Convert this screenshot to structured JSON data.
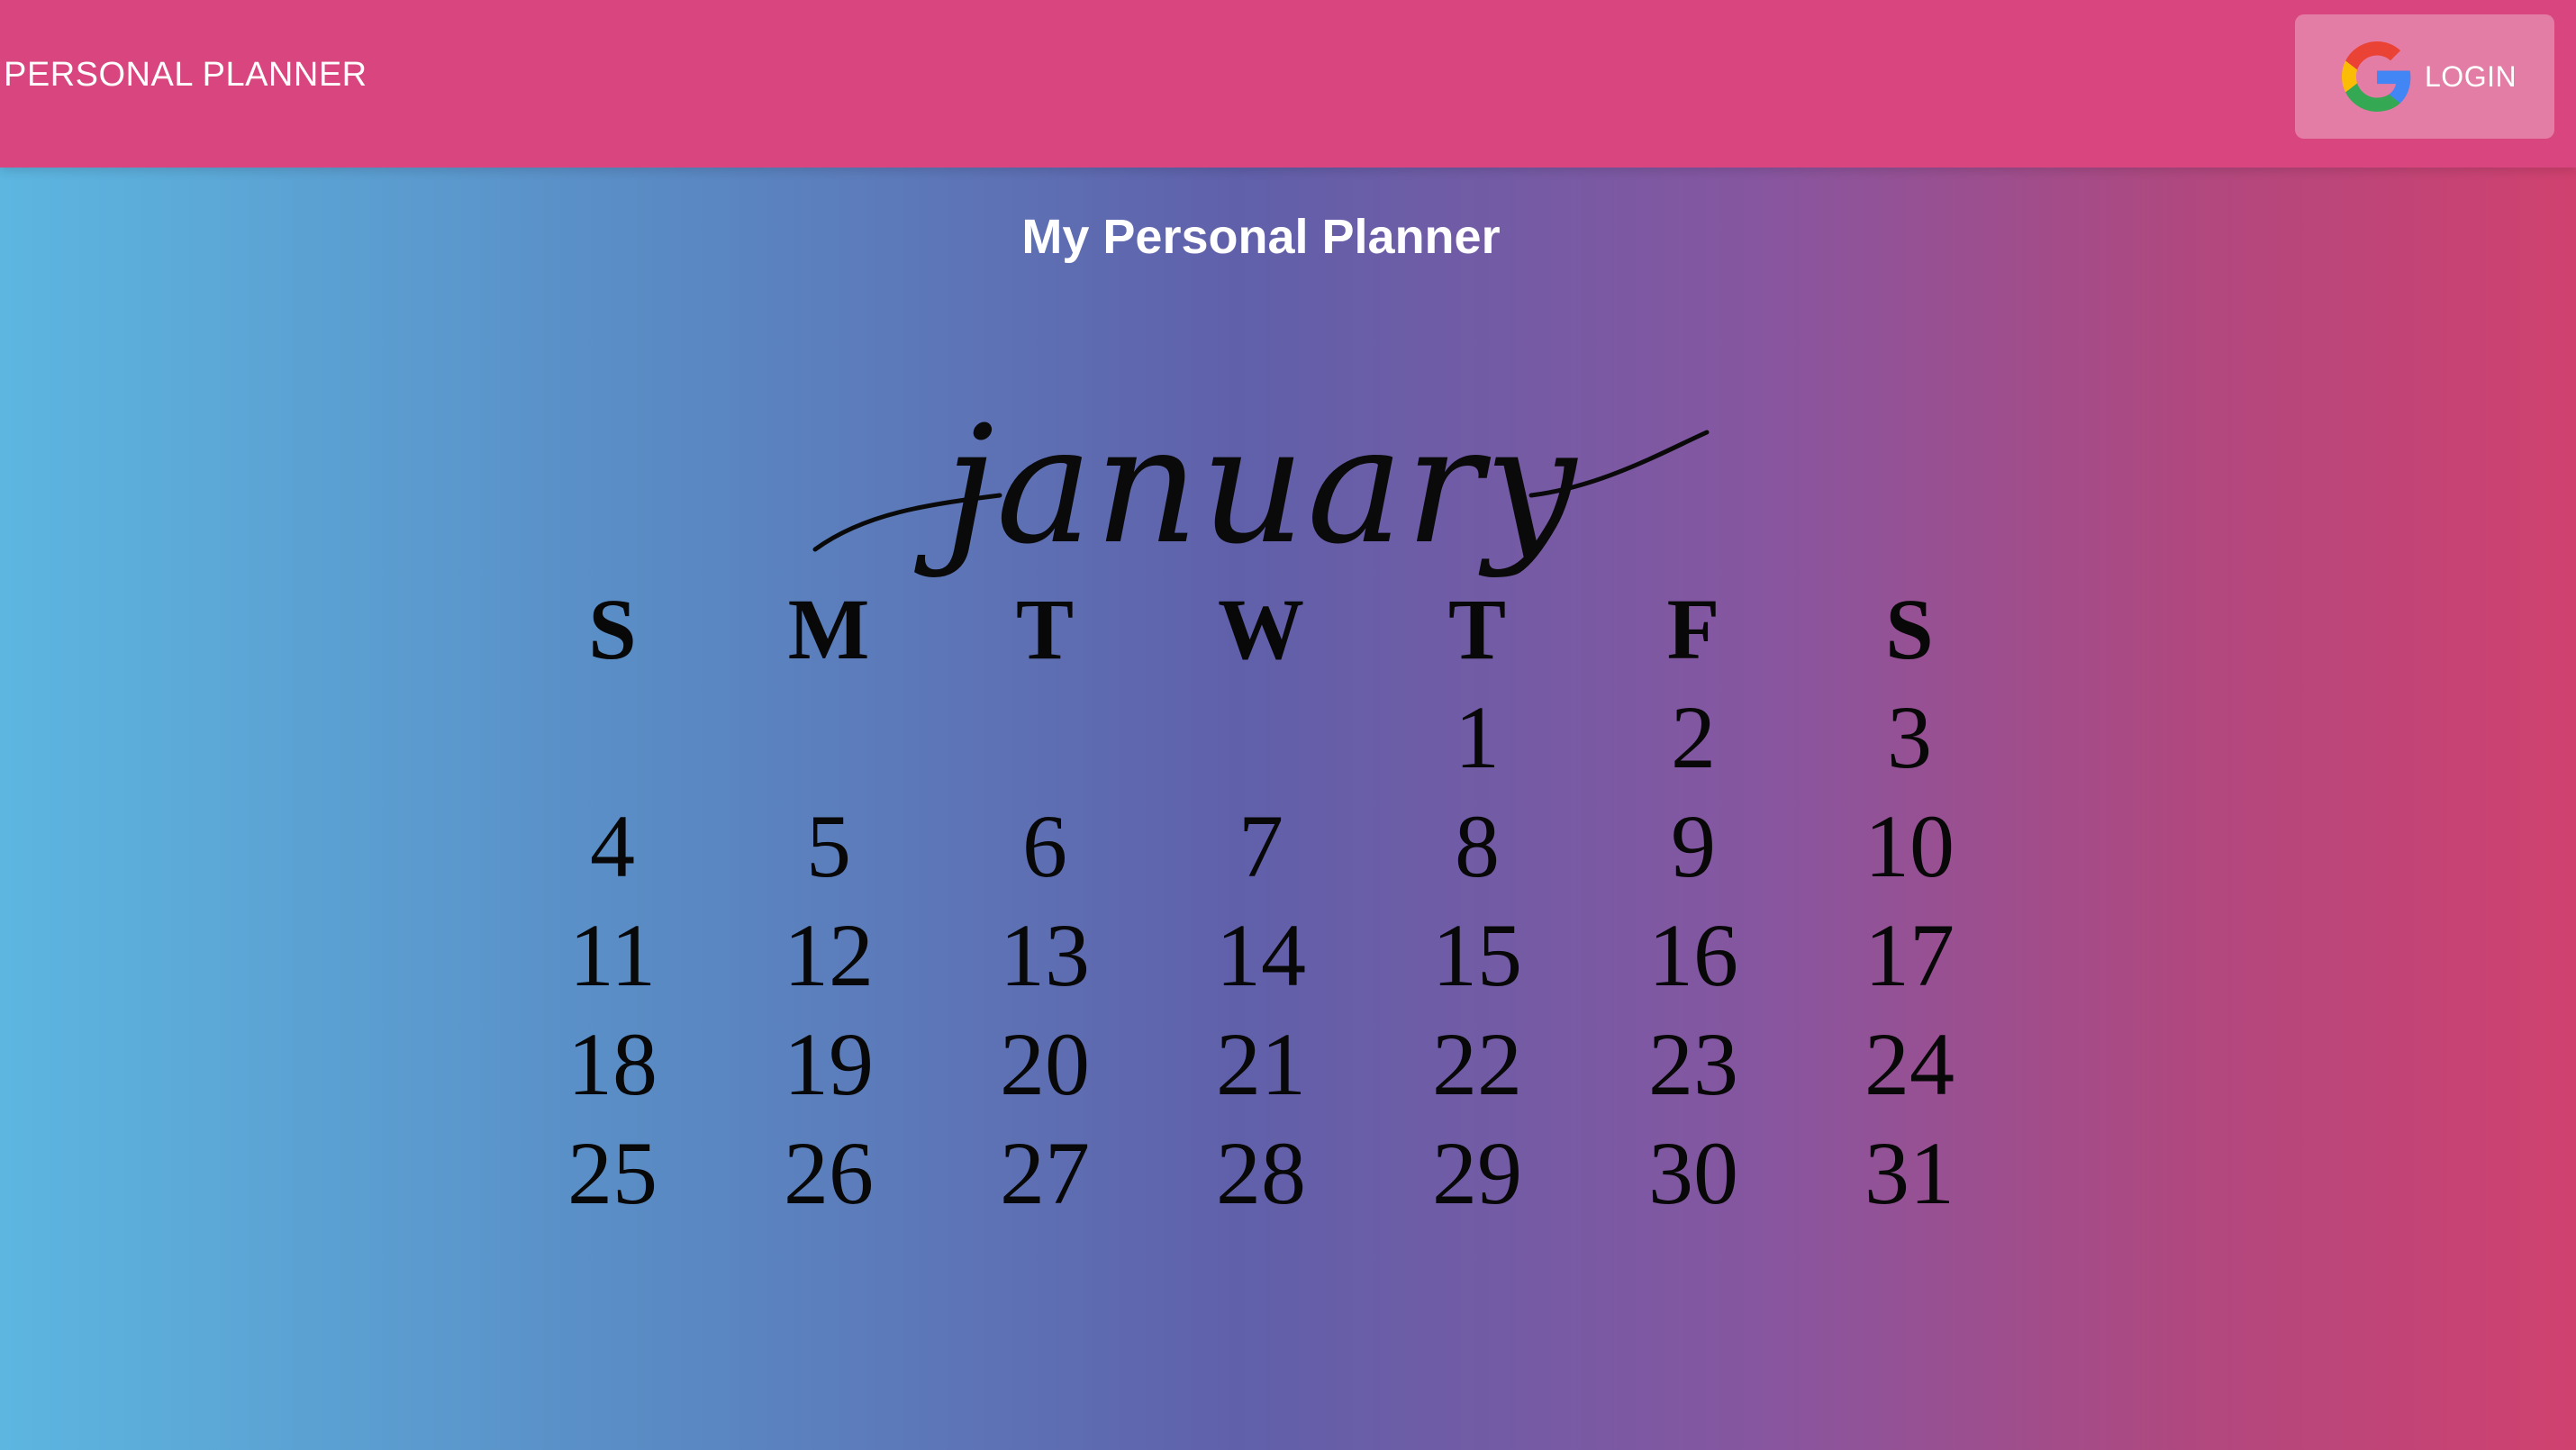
{
  "header": {
    "brand": "PERSONAL PLANNER",
    "login_label": "LOGIN",
    "login_icon": "google-g-icon",
    "bg_color": "#d9457f"
  },
  "main": {
    "title": "My Personal Planner"
  },
  "calendar": {
    "month": "january",
    "weekdays": [
      "S",
      "M",
      "T",
      "W",
      "T",
      "F",
      "S"
    ],
    "weeks": [
      [
        "",
        "",
        "",
        "",
        "1",
        "2",
        "3"
      ],
      [
        "4",
        "5",
        "6",
        "7",
        "8",
        "9",
        "10"
      ],
      [
        "11",
        "12",
        "13",
        "14",
        "15",
        "16",
        "17"
      ],
      [
        "18",
        "19",
        "20",
        "21",
        "22",
        "23",
        "24"
      ],
      [
        "25",
        "26",
        "27",
        "28",
        "29",
        "30",
        "31"
      ]
    ]
  }
}
